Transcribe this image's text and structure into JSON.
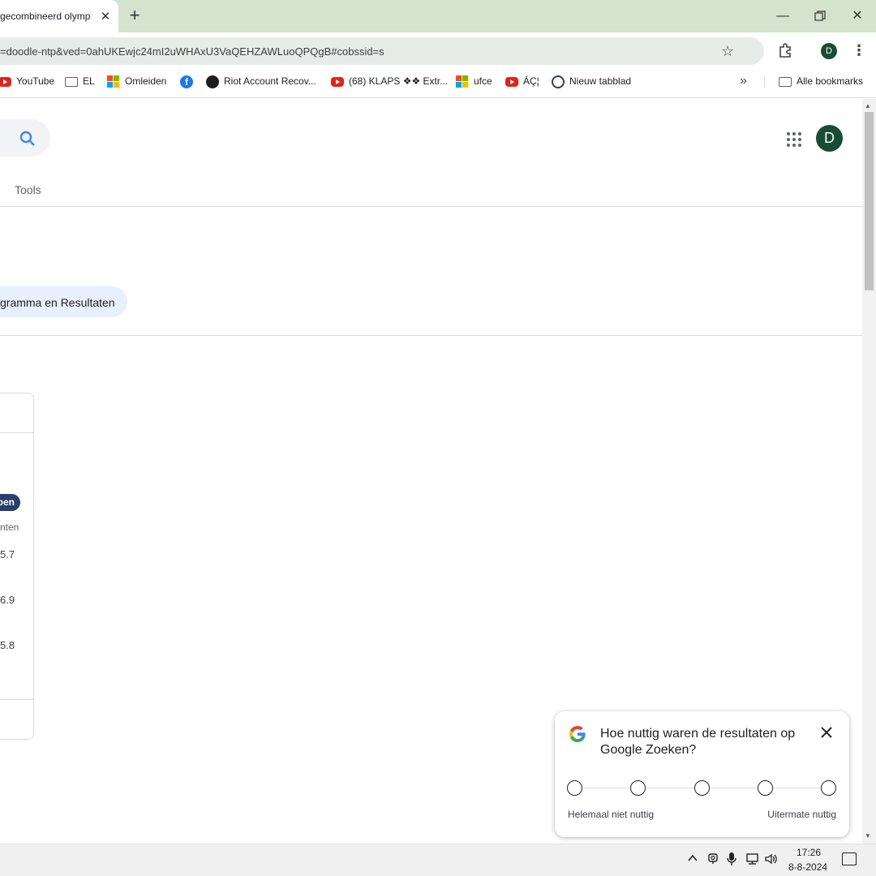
{
  "browser": {
    "tab_title": "gecombineerd olympi",
    "url": "=doodle-ntp&ved=0ahUKEwjc24mI2uWHAxU3VaQEHZAWLuoQPQgB#cobssid=s",
    "profile_initial": "D",
    "bookmarks": [
      {
        "label": "YouTube",
        "icon": "youtube-icon"
      },
      {
        "label": "EL",
        "icon": "folder-icon"
      },
      {
        "label": "Omleiden",
        "icon": "microsoft-icon"
      },
      {
        "label": "",
        "icon": "facebook-icon"
      },
      {
        "label": "Riot Account Recov...",
        "icon": "riot-icon"
      },
      {
        "label": "(68) KLAPS ❖❖ Extr...",
        "icon": "youtube-icon"
      },
      {
        "label": "ufce",
        "icon": "microsoft-icon"
      },
      {
        "label": "ÁÇ¦",
        "icon": "youtube-icon"
      },
      {
        "label": "Nieuw tabblad",
        "icon": "globe-icon"
      }
    ],
    "all_bookmarks": "Alle bookmarks"
  },
  "page": {
    "account_initial": "D",
    "tools_label": "Tools",
    "chip_label": "gramma en Resultaten",
    "card": {
      "badge": "pen",
      "subtitle": "nten",
      "scores": [
        "5.7",
        "6.9",
        "5.8"
      ]
    }
  },
  "feedback": {
    "question": "Hoe nuttig waren de resultaten op Google Zoeken?",
    "low_label": "Helemaal niet nuttig",
    "high_label": "Uitermate nuttig",
    "options": 5
  },
  "taskbar": {
    "time": "17:26",
    "date": "8-8-2024"
  },
  "colors": {
    "titlebar": "#d3e3cd",
    "avatar": "#174c35",
    "badge": "#28406b",
    "chip": "#e8f0fe"
  }
}
